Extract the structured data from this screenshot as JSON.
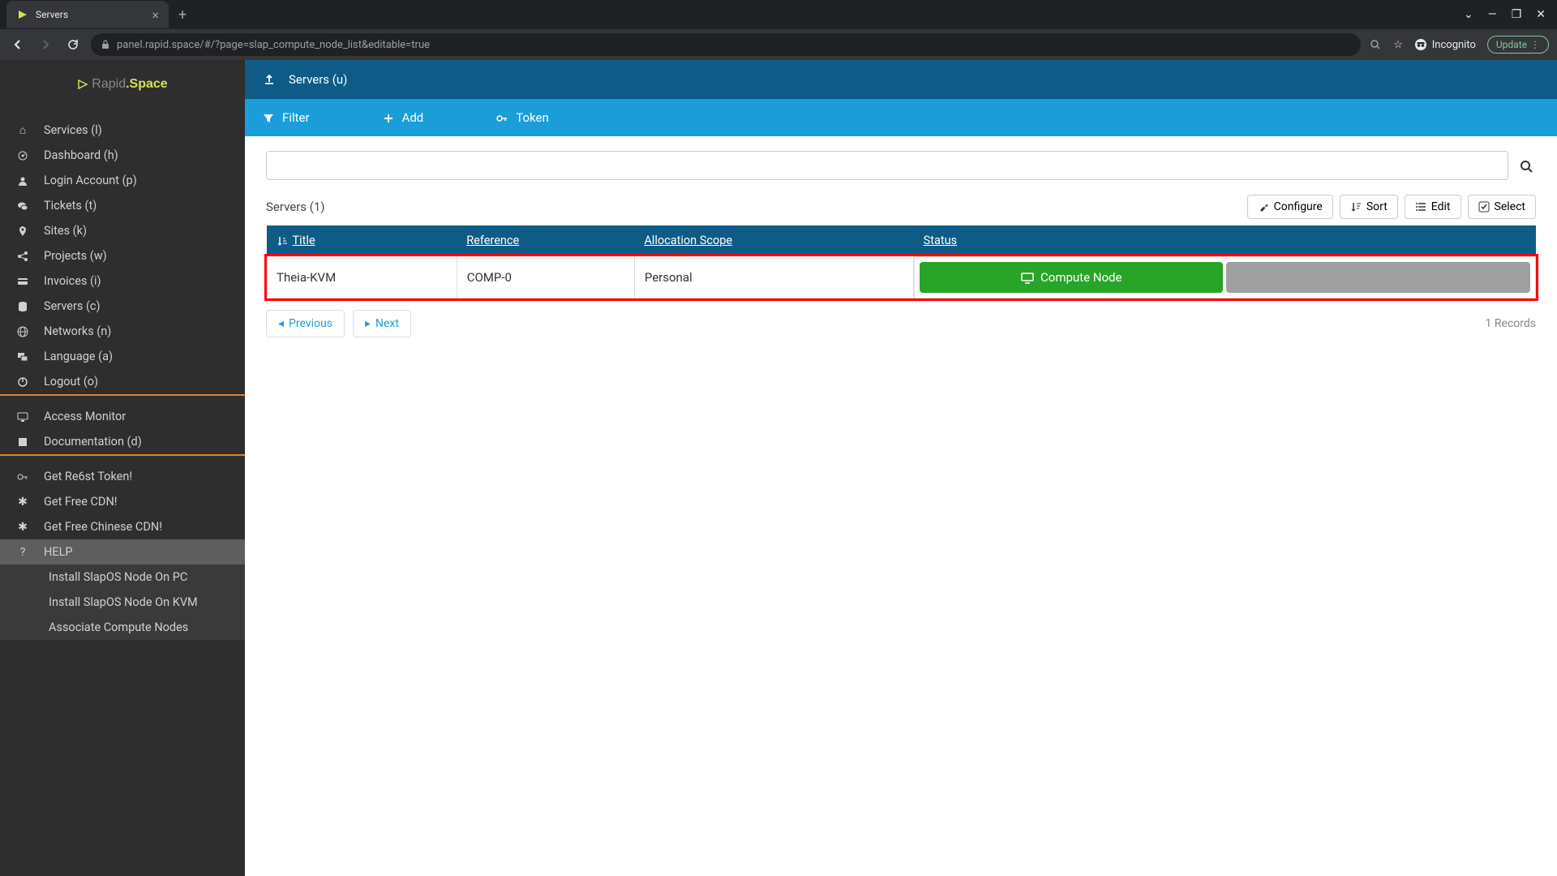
{
  "browser": {
    "tab_title": "Servers",
    "url": "panel.rapid.space/#/?page=slap_compute_node_list&editable=true",
    "incognito": "Incognito",
    "update": "Update"
  },
  "logo": {
    "rapid": "Rapid",
    "space": ".Space"
  },
  "sidebar": {
    "section1": [
      {
        "icon": "home",
        "label": "Services (l)"
      },
      {
        "icon": "dashboard",
        "label": "Dashboard (h)"
      },
      {
        "icon": "user",
        "label": "Login Account (p)"
      },
      {
        "icon": "comments",
        "label": "Tickets (t)"
      },
      {
        "icon": "pin",
        "label": "Sites (k)"
      },
      {
        "icon": "share",
        "label": "Projects (w)"
      },
      {
        "icon": "card",
        "label": "Invoices (i)"
      },
      {
        "icon": "database",
        "label": "Servers (c)"
      },
      {
        "icon": "globe",
        "label": "Networks (n)"
      },
      {
        "icon": "lang",
        "label": "Language (a)"
      },
      {
        "icon": "power",
        "label": "Logout (o)"
      }
    ],
    "section2": [
      {
        "icon": "monitor",
        "label": "Access Monitor"
      },
      {
        "icon": "book",
        "label": "Documentation (d)"
      }
    ],
    "section3": [
      {
        "icon": "key",
        "label": "Get Re6st Token!"
      },
      {
        "icon": "star",
        "label": "Get Free CDN!"
      },
      {
        "icon": "star",
        "label": "Get Free Chinese CDN!"
      }
    ],
    "help": {
      "title": "HELP",
      "items": [
        "Install SlapOS Node On PC",
        "Install SlapOS Node On KVM",
        "Associate Compute Nodes"
      ]
    }
  },
  "header": {
    "title": "Servers (u)"
  },
  "actions": {
    "filter": "Filter",
    "add": "Add",
    "token": "Token"
  },
  "table": {
    "title": "Servers (1)",
    "tools": {
      "configure": "Configure",
      "sort": "Sort",
      "edit": "Edit",
      "select": "Select"
    },
    "columns": {
      "title": "Title",
      "reference": "Reference",
      "allocation": "Allocation Scope",
      "status": "Status"
    },
    "row": {
      "title": "Theia-KVM",
      "reference": "COMP-0",
      "allocation": "Personal",
      "status_label": "Compute Node"
    }
  },
  "pager": {
    "previous": "Previous",
    "next": "Next",
    "records": "1 Records"
  }
}
